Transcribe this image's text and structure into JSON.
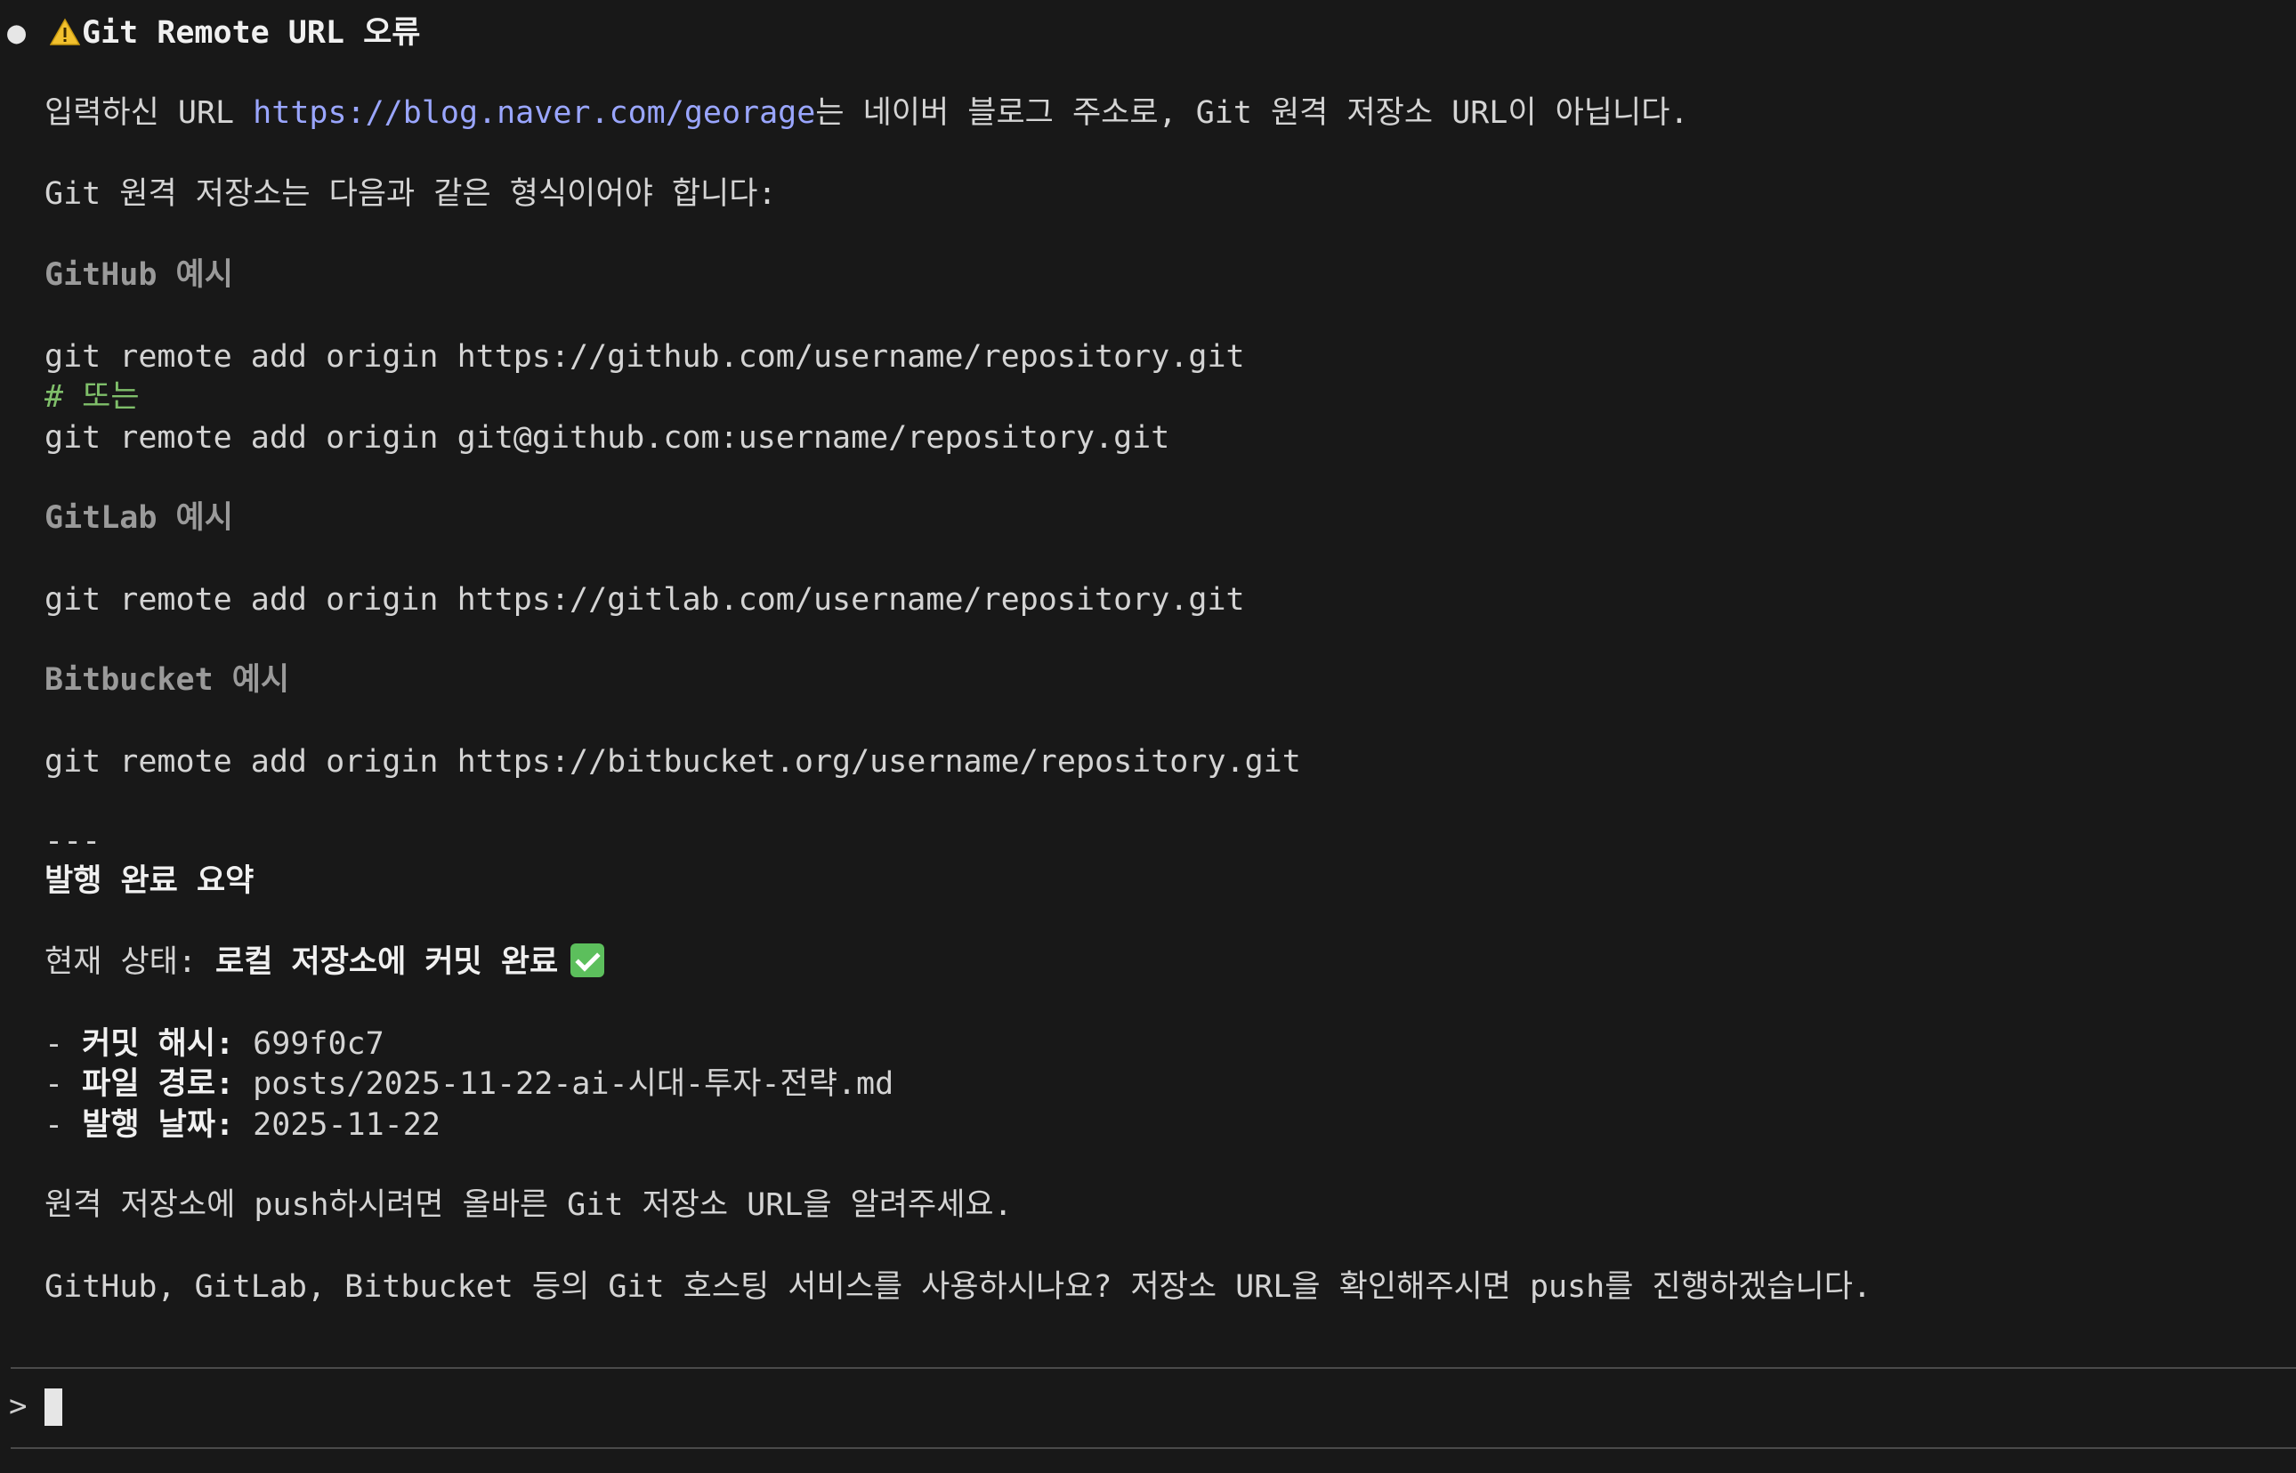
{
  "title": {
    "bullet": "●",
    "icon": "warning-icon",
    "text": "Git Remote URL 오류"
  },
  "intro": {
    "before": "입력하신 URL ",
    "link": "https://blog.naver.com/georage",
    "after": "는 네이버 블로그 주소로, Git 원격 저장소 URL이 아닙니다."
  },
  "format_note": "Git 원격 저장소는 다음과 같은 형식이어야 합니다:",
  "github": {
    "heading": "GitHub 예시",
    "cmd1": "git remote add origin https://github.com/username/repository.git",
    "comment": "# 또는",
    "cmd2": "git remote add origin git@github.com:username/repository.git"
  },
  "gitlab": {
    "heading": "GitLab 예시",
    "cmd": "git remote add origin https://gitlab.com/username/repository.git"
  },
  "bitbucket": {
    "heading": "Bitbucket 예시",
    "cmd": "git remote add origin https://bitbucket.org/username/repository.git"
  },
  "separator": "---",
  "summary": {
    "heading": "발행 완료 요약",
    "status_label": "현재 상태: ",
    "status_value": "로컬 저장소에 커밋 완료",
    "status_icon": "check-mark-icon",
    "items": [
      {
        "prefix": "- ",
        "label": "커밋 해시:",
        "value": " 699f0c7"
      },
      {
        "prefix": "- ",
        "label": "파일 경로:",
        "value": " posts/2025-11-22-ai-시대-투자-전략.md"
      },
      {
        "prefix": "- ",
        "label": "발행 날짜:",
        "value": " 2025-11-22"
      }
    ]
  },
  "push_request": "원격 저장소에 push하시려면 올바른 Git 저장소 URL을 알려주세요.",
  "question": "GitHub, GitLab, Bitbucket 등의 Git 호스팅 서비스를 사용하시나요? 저장소 URL을 확인해주시면 push를 진행하겠습니다.",
  "prompt": {
    "symbol": ">",
    "value": ""
  },
  "colors": {
    "background": "#181818",
    "text": "#d4d4d4",
    "link": "#9aa6ff",
    "comment": "#7fbf6a",
    "heading": "#9a9a9a",
    "success": "#5cbf5c"
  }
}
